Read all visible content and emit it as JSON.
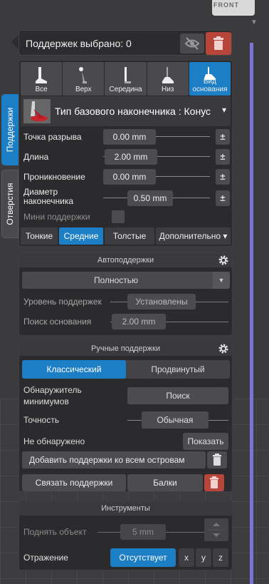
{
  "scene": {
    "view_cube_label": "FRONT"
  },
  "side_tabs": [
    "Поддержки",
    "Отверстия"
  ],
  "header": {
    "title": "Поддержек выбрано: 0"
  },
  "tips": {
    "items": [
      {
        "label": "Все",
        "active": false
      },
      {
        "label": "Верх",
        "active": false
      },
      {
        "label": "Середина",
        "active": false
      },
      {
        "label": "Низ",
        "active": false
      },
      {
        "label": "Вид основания",
        "active": true
      }
    ],
    "type_label": "Тип базового наконечника : Конус"
  },
  "params": [
    {
      "name": "Точка разрыва",
      "value": "0.00 mm"
    },
    {
      "name": "Длина",
      "value": "2.00 mm"
    },
    {
      "name": "Проникновение",
      "value": "0.00 mm"
    },
    {
      "name": "Диаметр наконечника",
      "value": "0.50 mm"
    }
  ],
  "mini_supports_label": "Мини поддержки",
  "sizes": [
    {
      "label": "Тонкие",
      "active": false
    },
    {
      "label": "Средние",
      "active": true
    },
    {
      "label": "Толстые",
      "active": false
    },
    {
      "label": "Дополнительно",
      "active": false
    }
  ],
  "auto": {
    "title": "Автоподдержки",
    "mode": "Полностью",
    "level_label": "Уровень поддержек",
    "level_value": "Установлены",
    "base_search_label": "Поиск основания",
    "base_search_value": "2.00 mm"
  },
  "manual": {
    "title": "Ручные поддержки",
    "modes": [
      {
        "label": "Классический",
        "active": true
      },
      {
        "label": "Продвинутый",
        "active": false
      }
    ],
    "minima_label": "Обнаружитель минимумов",
    "search_button": "Поиск",
    "accuracy_label": "Точность",
    "accuracy_value": "Обычная",
    "not_found_label": "Не обнаружено",
    "show_button": "Показать",
    "add_islands_button": "Добавить поддержки ко всем островам",
    "link_button": "Связать поддержки",
    "beams_button": "Балки"
  },
  "tools": {
    "title": "Инструменты",
    "lift_label": "Поднять объект",
    "lift_value": "5 mm",
    "mirror_label": "Отражение",
    "mirror_value": "Отсутствует",
    "axes": [
      "x",
      "y",
      "z"
    ]
  },
  "colors": {
    "accent": "#1c7ec4",
    "danger": "#b8453a",
    "panel": "#2b2b2e",
    "scrollbar": "#7b73d6"
  }
}
